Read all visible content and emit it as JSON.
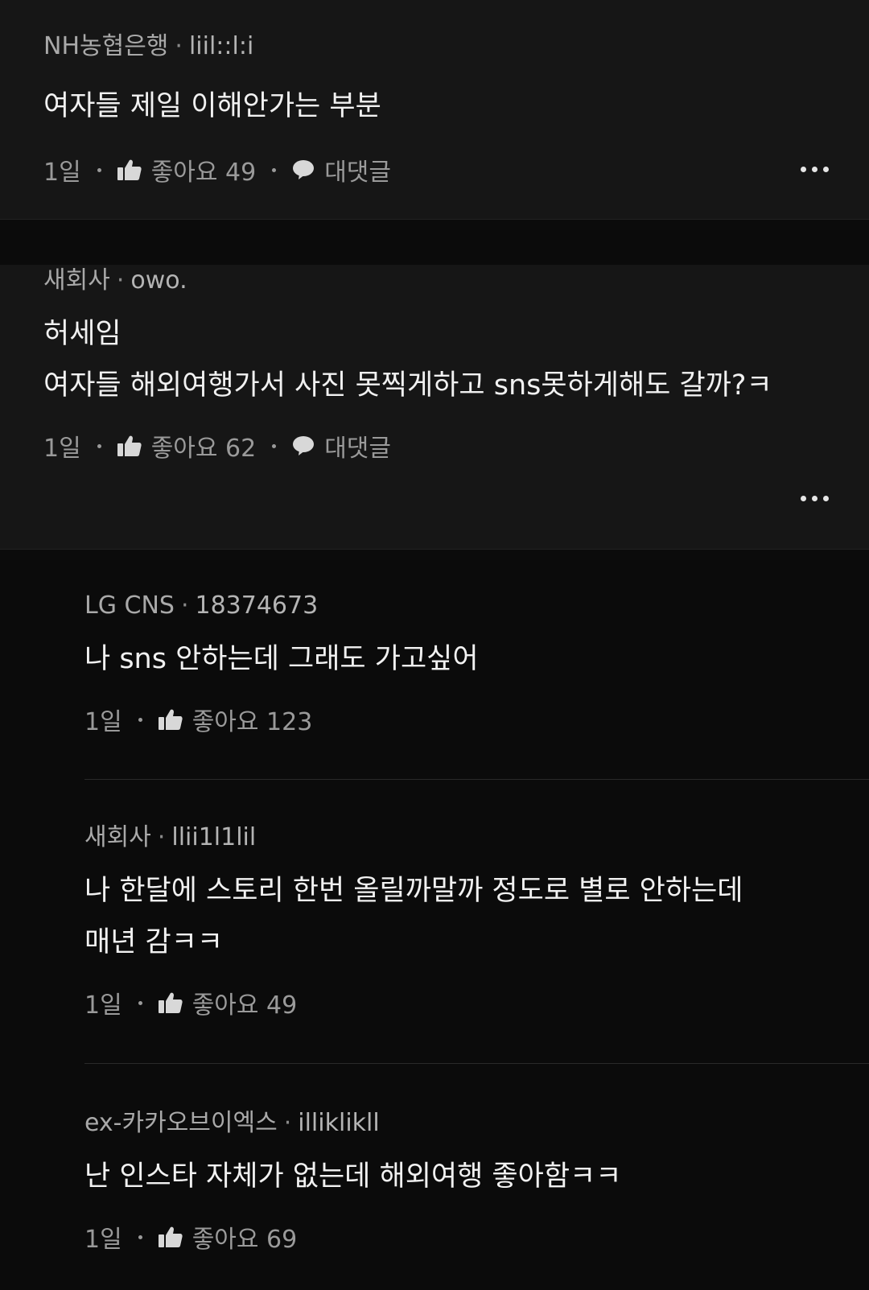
{
  "comments": [
    {
      "company": "NH농협은행",
      "nickname": "liil::l:i",
      "lines": [
        "여자들 제일 이해안가는 부분"
      ],
      "time": "1일",
      "likes_label": "좋아요 49",
      "reply_label": "대댓글"
    },
    {
      "company": "새회사",
      "nickname": "owo.",
      "lines": [
        "허세임",
        "여자들 해외여행가서 사진 못찍게하고 sns못하게해도 갈까?ㅋ"
      ],
      "time": "1일",
      "likes_label": "좋아요 62",
      "reply_label": "대댓글"
    }
  ],
  "replies": [
    {
      "company": "LG CNS",
      "nickname": "18374673",
      "lines": [
        "나 sns 안하는데 그래도 가고싶어"
      ],
      "time": "1일",
      "likes_label": "좋아요 123"
    },
    {
      "company": "새회사",
      "nickname": "llii1l1lil",
      "lines": [
        "나 한달에 스토리 한번 올릴까말까 정도로 별로 안하는데",
        "매년 감ㅋㅋ"
      ],
      "time": "1일",
      "likes_label": "좋아요 49"
    },
    {
      "company": "ex-카카오브이엑스",
      "nickname": "illiklikll",
      "lines": [
        "난 인스타 자체가 없는데 해외여행 좋아함ㅋㅋ"
      ],
      "time": "1일",
      "likes_label": "좋아요 69"
    }
  ],
  "separator": "·",
  "icons": {
    "like": "thumbs-up-icon",
    "reply": "speech-bubble-icon",
    "more": "more-options-icon"
  },
  "colors": {
    "comment_bg": "#161616",
    "reply_bg": "#0b0b0b",
    "text": "#f1f1f1",
    "muted": "#a9a9a9"
  }
}
